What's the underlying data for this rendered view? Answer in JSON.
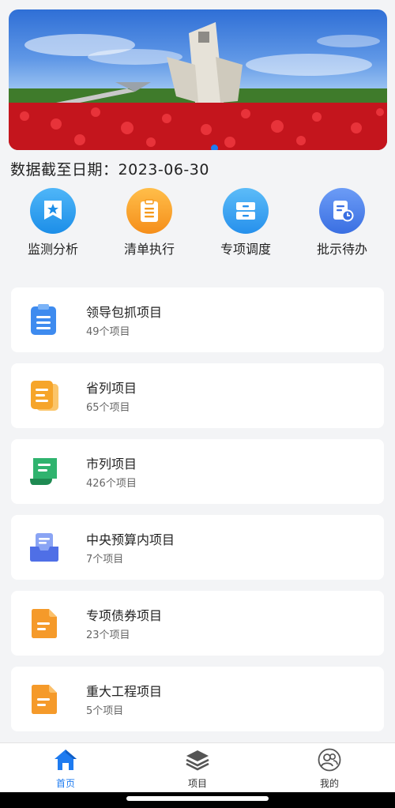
{
  "banner": {
    "alt": "banner",
    "active_index": 0
  },
  "date_line": {
    "label": "数据截至日期：",
    "value": "2023-06-30"
  },
  "quick_actions": [
    {
      "label": "监测分析",
      "icon": "star-badge-icon",
      "color": "#1c93ea"
    },
    {
      "label": "清单执行",
      "icon": "clipboard-icon",
      "color": "#f59a1c"
    },
    {
      "label": "专项调度",
      "icon": "drawer-icon",
      "color": "#2d97ee"
    },
    {
      "label": "批示待办",
      "icon": "document-clock-icon",
      "color": "#3c7ae8"
    }
  ],
  "projects": [
    {
      "title": "领导包抓项目",
      "count": "49个项目",
      "icon": "document-icon",
      "color": "#3e8bef"
    },
    {
      "title": "省列项目",
      "count": "65个项目",
      "icon": "stacked-document-icon",
      "color": "#f6a52a"
    },
    {
      "title": "市列项目",
      "count": "426个项目",
      "icon": "scroll-icon",
      "color": "#2fb36e"
    },
    {
      "title": "中央预算内项目",
      "count": "7个项目",
      "icon": "tray-document-icon",
      "color": "#4f6fe6"
    },
    {
      "title": "专项债券项目",
      "count": "23个项目",
      "icon": "folded-document-icon",
      "color": "#f59a2a"
    },
    {
      "title": "重大工程项目",
      "count": "5个项目",
      "icon": "folded-document-icon",
      "color": "#f59a2a"
    }
  ],
  "tabs": [
    {
      "label": "首页",
      "icon": "home-icon",
      "active": true,
      "color": "#1e7bf0"
    },
    {
      "label": "项目",
      "icon": "layers-icon",
      "active": false,
      "color": "#333333"
    },
    {
      "label": "我的",
      "icon": "user-group-icon",
      "active": false,
      "color": "#333333"
    }
  ]
}
